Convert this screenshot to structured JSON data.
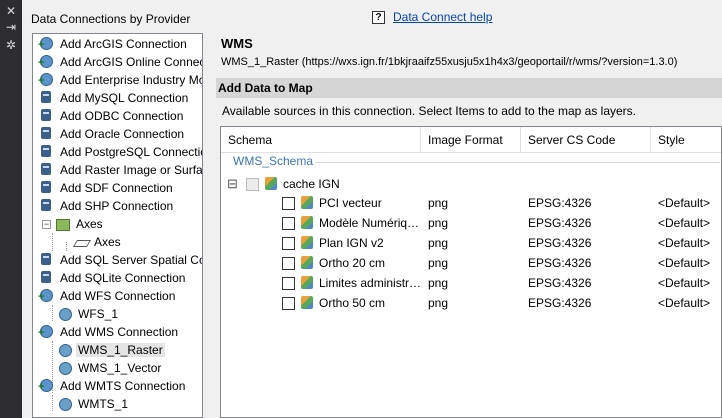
{
  "sidebar_strip": {
    "close_glyph": "✕",
    "pin_glyph": "⇥",
    "settings_glyph": "✲"
  },
  "left_panel": {
    "title": "Data Connections by Provider",
    "tree": [
      {
        "label": "Add ArcGIS Connection",
        "icon": "connection-icon"
      },
      {
        "label": "Add ArcGIS Online Connecti",
        "icon": "connection-icon"
      },
      {
        "label": "Add Enterprise Industry Mo",
        "icon": "connection-icon"
      },
      {
        "label": "Add MySQL Connection",
        "icon": "server-icon"
      },
      {
        "label": "Add ODBC Connection",
        "icon": "server-icon"
      },
      {
        "label": "Add Oracle Connection",
        "icon": "server-icon"
      },
      {
        "label": "Add PostgreSQL Connection",
        "icon": "server-icon"
      },
      {
        "label": "Add Raster Image or Surfac",
        "icon": "server-icon"
      },
      {
        "label": "Add SDF Connection",
        "icon": "server-icon"
      },
      {
        "label": "Add SHP Connection",
        "icon": "server-icon"
      },
      {
        "label": "Axes",
        "icon": "shp-source-icon"
      },
      {
        "label": "Axes",
        "icon": "layer-icon"
      },
      {
        "label": "Add SQL Server Spatial Con",
        "icon": "server-icon"
      },
      {
        "label": "Add SQLite Connection",
        "icon": "server-icon"
      },
      {
        "label": "Add WFS Connection",
        "icon": "connection-icon"
      },
      {
        "label": "WFS_1",
        "icon": "wms-source-icon"
      },
      {
        "label": "Add WMS Connection",
        "icon": "connection-icon"
      },
      {
        "label": "WMS_1_Raster",
        "icon": "wms-source-icon"
      },
      {
        "label": "WMS_1_Vector",
        "icon": "wms-source-icon"
      },
      {
        "label": "Add WMTS Connection",
        "icon": "connection-icon"
      },
      {
        "label": "WMTS_1",
        "icon": "wms-source-icon"
      }
    ]
  },
  "help": {
    "icon_glyph": "?",
    "link": "Data Connect help"
  },
  "main": {
    "title": "WMS",
    "subtitle": "WMS_1_Raster (https://wxs.ign.fr/1bkjraaifz55xusju5x1h4x3/geoportail/r/wms/?version=1.3.0)",
    "section_title": "Add Data to Map",
    "instructions": "Available sources in this connection.  Select Items to add to the map as layers.",
    "columns": [
      "Schema",
      "Image Format",
      "Server CS Code",
      "Style"
    ],
    "schema_group": "WMS_Schema",
    "collapse_glyph": "⊟",
    "parent_layer": "cache IGN",
    "rows": [
      {
        "name": "PCI vecteur",
        "format": "png",
        "cs_code": "EPSG:4326",
        "style": "<Default>"
      },
      {
        "name": "Modèle Numériq…",
        "format": "png",
        "cs_code": "EPSG:4326",
        "style": "<Default>"
      },
      {
        "name": "Plan IGN v2",
        "format": "png",
        "cs_code": "EPSG:4326",
        "style": "<Default>"
      },
      {
        "name": "Ortho 20 cm",
        "format": "png",
        "cs_code": "EPSG:4326",
        "style": "<Default>"
      },
      {
        "name": "Limites administr…",
        "format": "png",
        "cs_code": "EPSG:4326",
        "style": "<Default>"
      },
      {
        "name": "Ortho 50 cm",
        "format": "png",
        "cs_code": "EPSG:4326",
        "style": "<Default>"
      }
    ]
  }
}
